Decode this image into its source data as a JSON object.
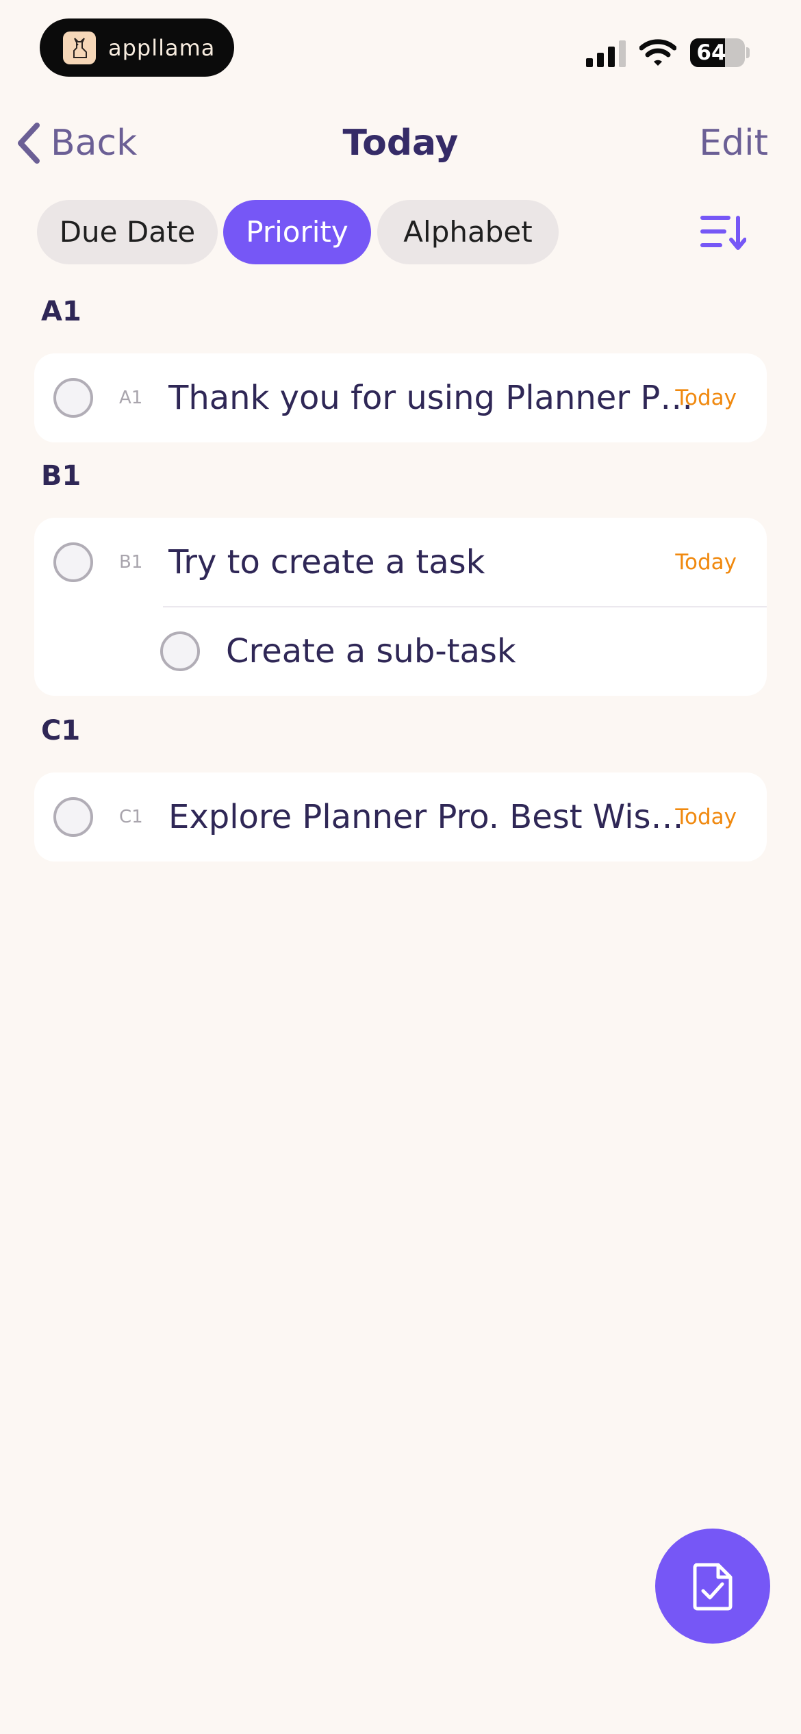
{
  "status_bar": {
    "app_badge_label": "appllama",
    "battery_percent": "64",
    "battery_level": 0.64
  },
  "nav": {
    "back_label": "Back",
    "title": "Today",
    "edit_label": "Edit"
  },
  "sort_options": {
    "due_date": "Due Date",
    "priority": "Priority",
    "alphabet": "Alphabet",
    "selected": "Priority"
  },
  "sections": [
    {
      "header": "A1",
      "tasks": [
        {
          "priority": "A1",
          "title": "Thank you for using Planner P…",
          "due": "Today"
        }
      ]
    },
    {
      "header": "B1",
      "tasks": [
        {
          "priority": "B1",
          "title": "Try to create a task",
          "due": "Today",
          "subtasks": [
            {
              "title": "Create a sub-task"
            }
          ]
        }
      ]
    },
    {
      "header": "C1",
      "tasks": [
        {
          "priority": "C1",
          "title": "Explore Planner Pro. Best Wis…",
          "due": "Today"
        }
      ]
    }
  ],
  "colors": {
    "background": "#fcf7f3",
    "accent": "#7657f6",
    "due_today": "#f0890f",
    "text_primary": "#2f2756"
  },
  "icons": {
    "back": "chevron-left-icon",
    "sort": "sort-order-icon",
    "fab": "new-task-document-check-icon"
  }
}
